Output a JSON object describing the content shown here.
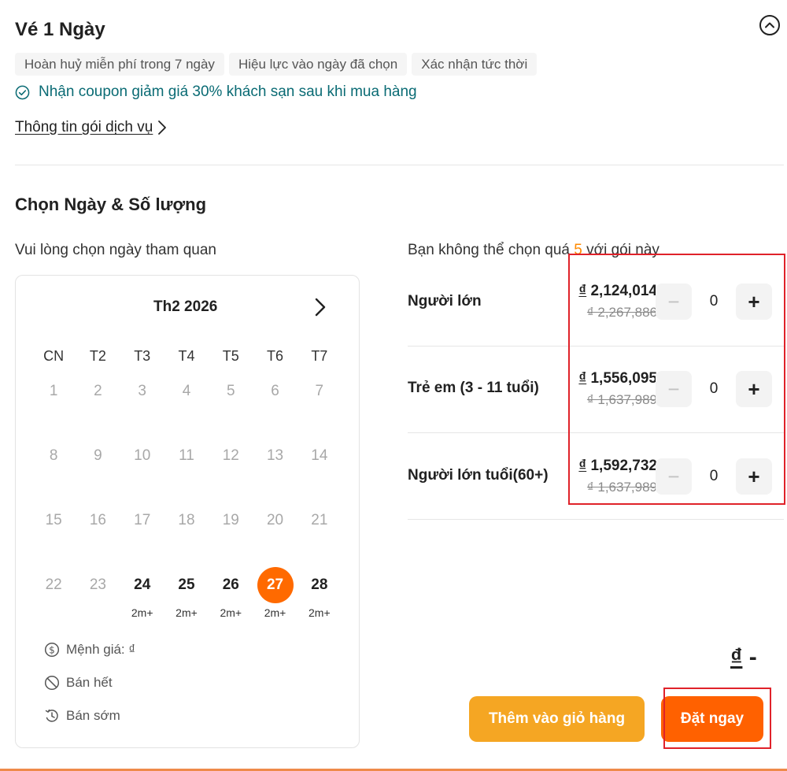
{
  "package": {
    "title": "Vé 1 Ngày",
    "tags": [
      "Hoàn huỷ miễn phí trong 7 ngày",
      "Hiệu lực vào ngày đã chọn",
      "Xác nhận tức thời"
    ],
    "coupon_text": "Nhận coupon giảm giá 30% khách sạn sau khi mua hàng",
    "info_link": "Thông tin gói dịch vụ",
    "collapse_icon": "chevron-up-circle-icon"
  },
  "selection": {
    "section_title": "Chọn Ngày & Số lượng",
    "date_hint": "Vui lòng chọn ngày tham quan",
    "qty_hint_prefix": "Bạn không thể chọn quá",
    "qty_limit": "5",
    "qty_hint_suffix": "với gói này"
  },
  "calendar": {
    "month_label": "Th2 2026",
    "weekdays": [
      "CN",
      "T2",
      "T3",
      "T4",
      "T5",
      "T6",
      "T7"
    ],
    "weeks": [
      [
        {
          "d": "1",
          "avail": false
        },
        {
          "d": "2",
          "avail": false
        },
        {
          "d": "3",
          "avail": false
        },
        {
          "d": "4",
          "avail": false
        },
        {
          "d": "5",
          "avail": false
        },
        {
          "d": "6",
          "avail": false
        },
        {
          "d": "7",
          "avail": false
        }
      ],
      [
        {
          "d": "8",
          "avail": false
        },
        {
          "d": "9",
          "avail": false
        },
        {
          "d": "10",
          "avail": false
        },
        {
          "d": "11",
          "avail": false
        },
        {
          "d": "12",
          "avail": false
        },
        {
          "d": "13",
          "avail": false
        },
        {
          "d": "14",
          "avail": false
        }
      ],
      [
        {
          "d": "15",
          "avail": false
        },
        {
          "d": "16",
          "avail": false
        },
        {
          "d": "17",
          "avail": false
        },
        {
          "d": "18",
          "avail": false
        },
        {
          "d": "19",
          "avail": false
        },
        {
          "d": "20",
          "avail": false
        },
        {
          "d": "21",
          "avail": false
        }
      ],
      [
        {
          "d": "22",
          "avail": false
        },
        {
          "d": "23",
          "avail": false
        },
        {
          "d": "24",
          "avail": true,
          "sub": "2m+"
        },
        {
          "d": "25",
          "avail": true,
          "sub": "2m+"
        },
        {
          "d": "26",
          "avail": true,
          "sub": "2m+"
        },
        {
          "d": "27",
          "avail": true,
          "selected": true,
          "sub": "2m+"
        },
        {
          "d": "28",
          "avail": true,
          "sub": "2m+"
        }
      ]
    ],
    "legend": [
      {
        "icon": "dollar-circle-icon",
        "label": "Mệnh giá: ₫"
      },
      {
        "icon": "sold-out-icon",
        "label": "Bán hết"
      },
      {
        "icon": "early-clock-icon",
        "label": "Bán sớm"
      }
    ]
  },
  "tickets": [
    {
      "label": "Người lớn",
      "currency": "₫",
      "price": "2,124,014",
      "old_price": "₫ 2,267,886",
      "qty": "0"
    },
    {
      "label": "Trẻ em (3 - 11 tuổi)",
      "currency": "₫",
      "price": "1,556,095",
      "old_price": "₫ 1,637,989",
      "qty": "0"
    },
    {
      "label": "Người lớn tuổi(60+)",
      "currency": "₫",
      "price": "1,592,732",
      "old_price": "₫ 1,637,989",
      "qty": "0"
    }
  ],
  "summary": {
    "currency": "₫",
    "total": "-",
    "add_to_cart": "Thêm vào giỏ hàng",
    "book_now": "Đặt ngay"
  },
  "colors": {
    "accent": "#ff6100",
    "cart_button": "#f5a623",
    "highlight_box": "#e0222a",
    "coupon_text": "#0a6b74"
  }
}
